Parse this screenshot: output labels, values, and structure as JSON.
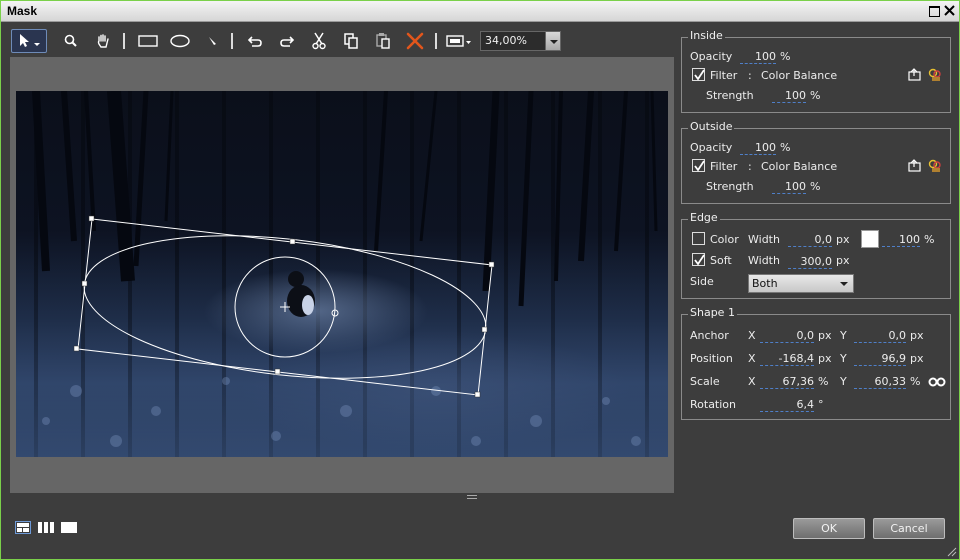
{
  "window": {
    "title": "Mask"
  },
  "toolbar": {
    "tools": [
      "select-icon",
      "zoom-icon",
      "hand-icon",
      "rectangle-icon",
      "ellipse-icon",
      "pen-icon",
      "undo-icon",
      "redo-icon",
      "cut-icon",
      "copy-icon",
      "paste-icon",
      "delete-icon",
      "fit-icon"
    ],
    "zoom_value": "34,00%"
  },
  "inside": {
    "title": "Inside",
    "opacity_label": "Opacity",
    "opacity_value": "100",
    "opacity_unit": "%",
    "filter_label": "Filter",
    "filter_checked": true,
    "filter_colon": ":",
    "filter_name": "Color Balance",
    "strength_label": "Strength",
    "strength_value": "100",
    "strength_unit": "%"
  },
  "outside": {
    "title": "Outside",
    "opacity_label": "Opacity",
    "opacity_value": "100",
    "opacity_unit": "%",
    "filter_label": "Filter",
    "filter_checked": true,
    "filter_colon": ":",
    "filter_name": "Color Balance",
    "strength_label": "Strength",
    "strength_value": "100",
    "strength_unit": "%"
  },
  "edge": {
    "title": "Edge",
    "color_label": "Color",
    "color_checked": false,
    "color_width_label": "Width",
    "color_width_value": "0,0",
    "color_width_unit": "px",
    "color_swatch": "#ffffff",
    "color_opacity_value": "100",
    "color_opacity_unit": "%",
    "soft_label": "Soft",
    "soft_checked": true,
    "soft_width_label": "Width",
    "soft_width_value": "300,0",
    "soft_width_unit": "px",
    "side_label": "Side",
    "side_value": "Both"
  },
  "shape": {
    "title": "Shape 1",
    "anchor_label": "Anchor",
    "anchor_x_label": "X",
    "anchor_x": "0,0",
    "anchor_x_unit": "px",
    "anchor_y_label": "Y",
    "anchor_y": "0,0",
    "anchor_y_unit": "px",
    "position_label": "Position",
    "position_x_label": "X",
    "position_x": "-168,4",
    "position_x_unit": "px",
    "position_y_label": "Y",
    "position_y": "96,9",
    "position_y_unit": "px",
    "scale_label": "Scale",
    "scale_x_label": "X",
    "scale_x": "67,36",
    "scale_x_unit": "%",
    "scale_y_label": "Y",
    "scale_y": "60,33",
    "scale_y_unit": "%",
    "rotation_label": "Rotation",
    "rotation_value": "6,4",
    "rotation_unit": "°"
  },
  "footer": {
    "ok_label": "OK",
    "cancel_label": "Cancel"
  },
  "colors": {
    "window_border": "#7ad04a",
    "panel_bg": "#3d3d3d",
    "value_underline": "#4f7fc8"
  }
}
